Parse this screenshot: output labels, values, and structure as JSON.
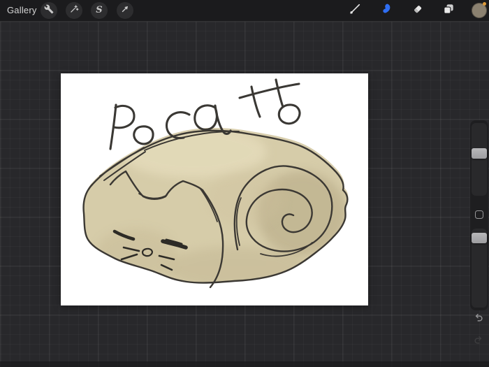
{
  "topbar": {
    "gallery_label": "Gallery",
    "left_tools": [
      {
        "id": "actions",
        "icon": "wrench-icon"
      },
      {
        "id": "adjustments",
        "icon": "magic-wand-icon"
      },
      {
        "id": "selection",
        "icon": "selection-s-icon",
        "glyph": "S"
      },
      {
        "id": "transform",
        "icon": "transform-arrow-icon"
      }
    ],
    "right_tools": [
      {
        "id": "paint",
        "icon": "paintbrush-icon",
        "active": false
      },
      {
        "id": "smudge",
        "icon": "smudge-finger-icon",
        "active": true
      },
      {
        "id": "erase",
        "icon": "eraser-icon",
        "active": false
      },
      {
        "id": "layers",
        "icon": "layers-icon",
        "active": false
      },
      {
        "id": "color",
        "icon": "color-swatch",
        "active": false
      }
    ],
    "active_tool": "smudge",
    "accent_color": "#2f6ef2",
    "current_color_hex": "#8b8170",
    "swatch_badge_color": "#de9b3a"
  },
  "canvas": {
    "drawing_text": "Pocatto",
    "paper_color": "#ffffff",
    "ink_color": "#3b3833",
    "fill_color": "#d8cead",
    "subject": "sleeping cat loaf doodle with swirl tail"
  },
  "sidebar": {
    "top_slider": {
      "name": "brush-size"
    },
    "bottom_slider": {
      "name": "opacity"
    },
    "modify_button": {
      "name": "modify"
    },
    "undo": {
      "icon": "undo-arrow-icon"
    },
    "redo": {
      "icon": "redo-arrow-icon"
    }
  }
}
